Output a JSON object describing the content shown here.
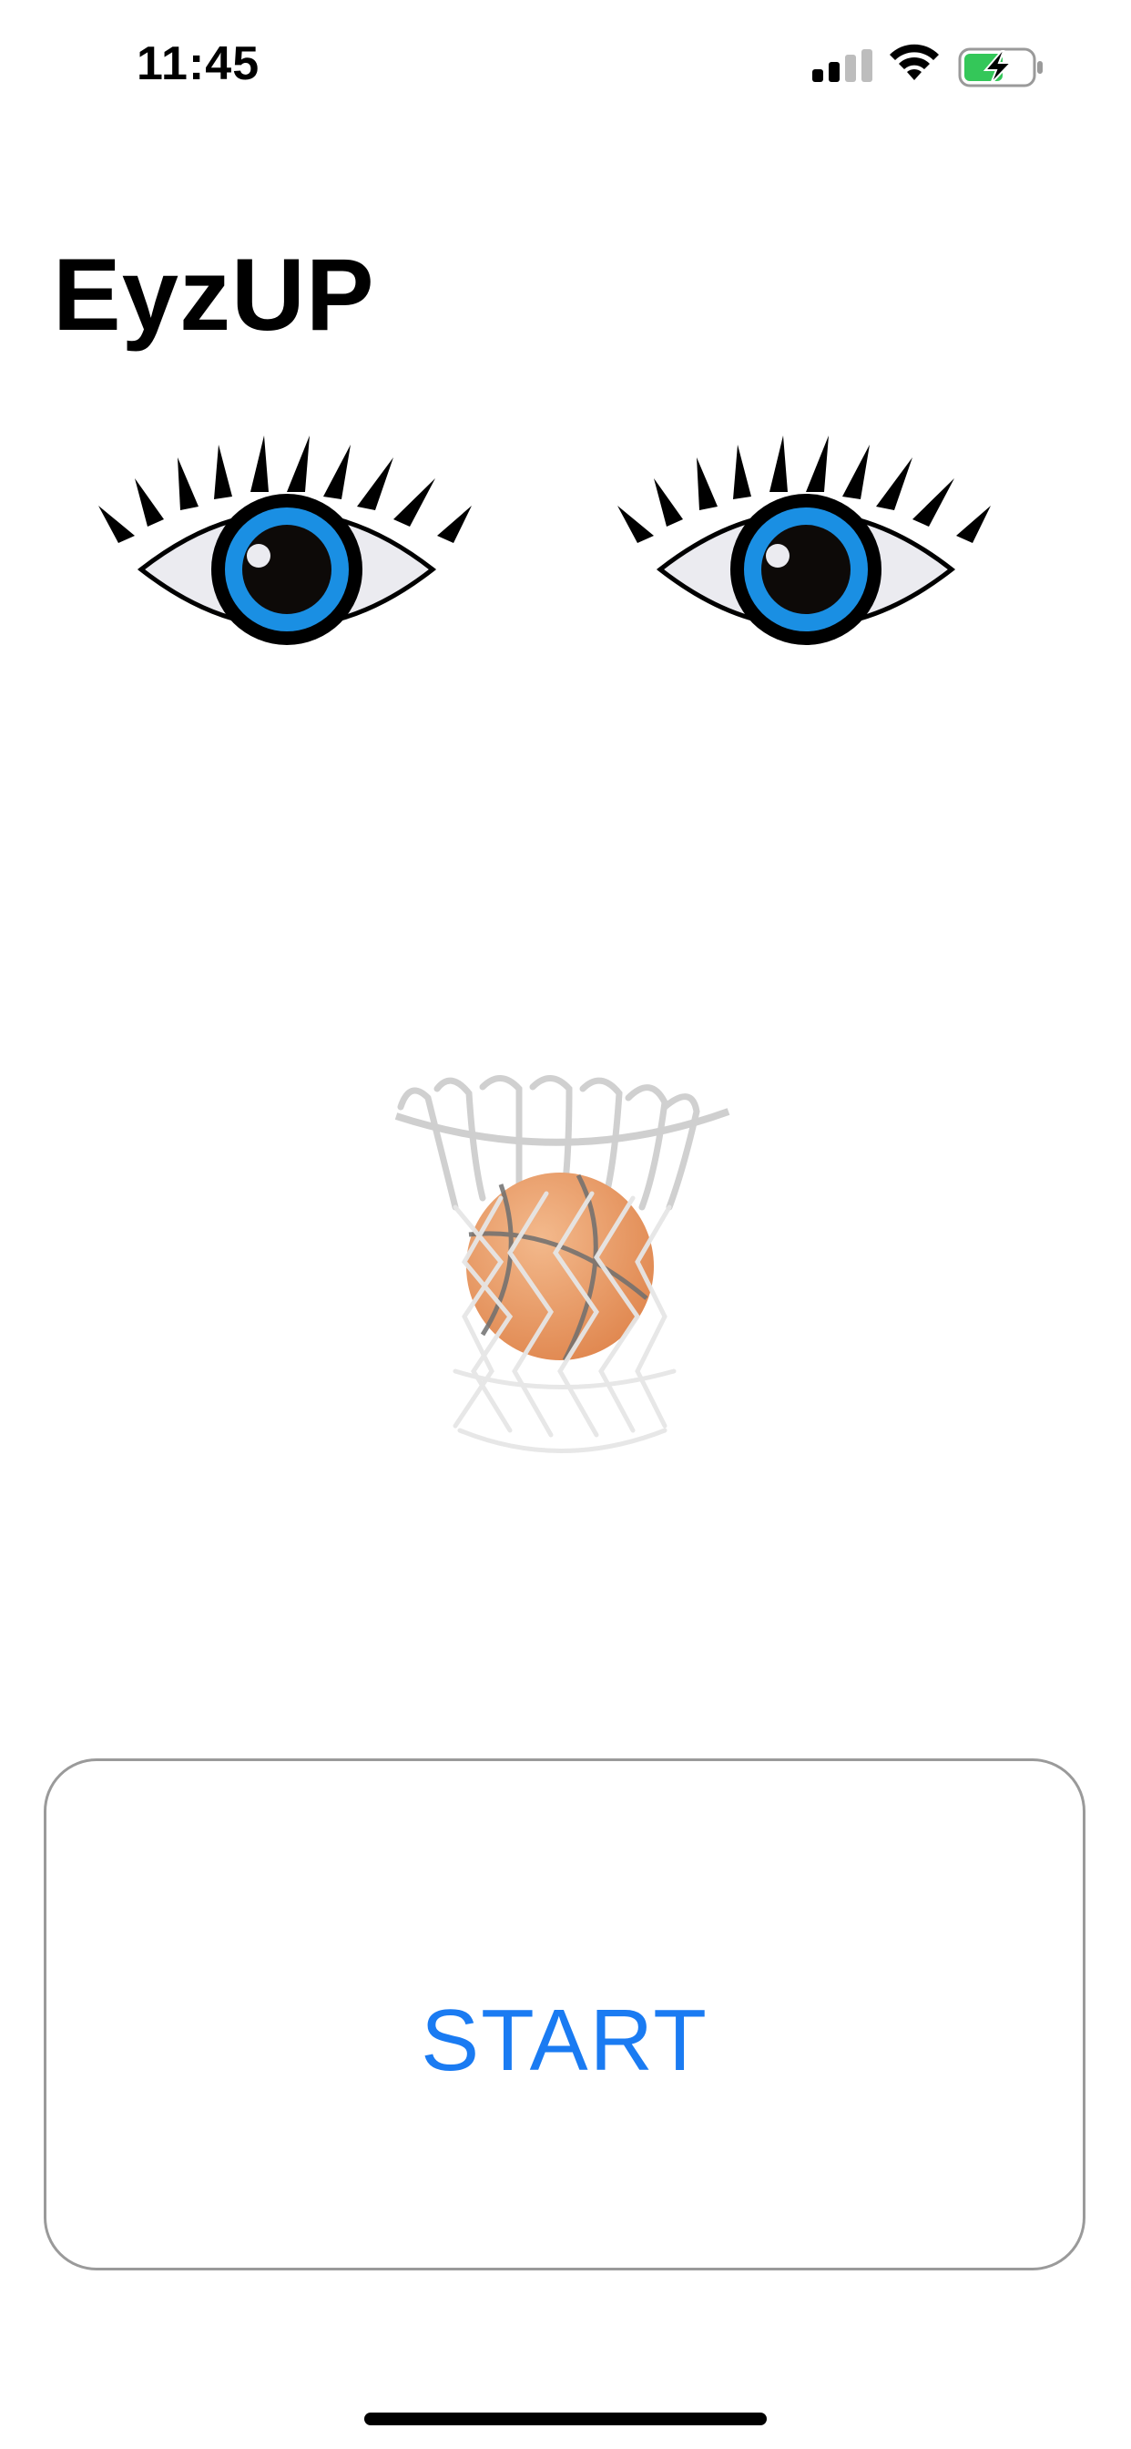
{
  "status_bar": {
    "time": "11:45",
    "signal_icon": "cellular-signal-icon",
    "wifi_icon": "wifi-icon",
    "battery_icon": "battery-charging-icon",
    "battery_color": "#34c759"
  },
  "app": {
    "title": "EyzUP"
  },
  "illustrations": {
    "eyes": "eyes-icon",
    "iris_color": "#1a8fe3",
    "hoop": "basketball-hoop-icon",
    "ball_color": "#e99a63"
  },
  "start_button": {
    "label": "START",
    "color": "#1a7bf2"
  }
}
